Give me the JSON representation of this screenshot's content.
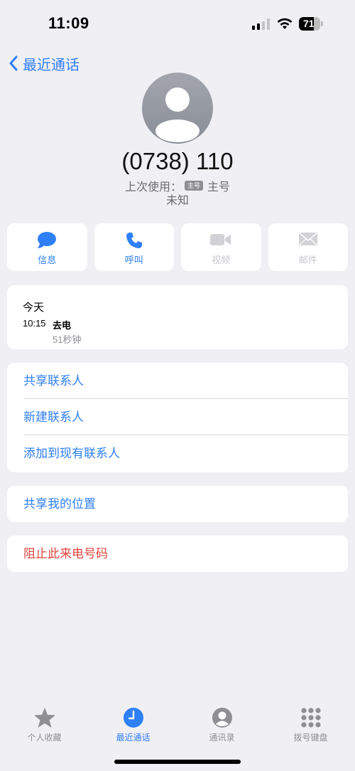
{
  "status_bar": {
    "time": "11:09",
    "battery_level": "71",
    "battery_fraction": 0.71
  },
  "nav": {
    "back_label": "最近通话"
  },
  "contact": {
    "phone_number": "(0738) 110",
    "last_used_prefix": "上次使用：",
    "sim_badge": "主号",
    "sim_name": "主号",
    "location": "未知"
  },
  "actions": [
    {
      "label": "信息",
      "icon": "message-bubble-icon",
      "enabled": true
    },
    {
      "label": "呼叫",
      "icon": "phone-icon",
      "enabled": true
    },
    {
      "label": "视频",
      "icon": "video-camera-icon",
      "enabled": false
    },
    {
      "label": "邮件",
      "icon": "envelope-icon",
      "enabled": false
    }
  ],
  "recent": {
    "day": "今天",
    "time": "10:15",
    "type": "去电",
    "duration": "51秒钟"
  },
  "contact_options": [
    "共享联系人",
    "新建联系人",
    "添加到现有联系人"
  ],
  "share_location": "共享我的位置",
  "block_caller": "阻止此来电号码",
  "tabs": [
    {
      "label": "个人收藏",
      "icon": "star-icon",
      "active": false
    },
    {
      "label": "最近通话",
      "icon": "clock-icon",
      "active": true
    },
    {
      "label": "通讯录",
      "icon": "person-circle-icon",
      "active": false
    },
    {
      "label": "拨号键盘",
      "icon": "keypad-icon",
      "active": false
    }
  ],
  "colors": {
    "accent": "#2f7ff6",
    "danger": "#e1453d",
    "background": "#efeff4",
    "inactive": "#8e8e93"
  }
}
